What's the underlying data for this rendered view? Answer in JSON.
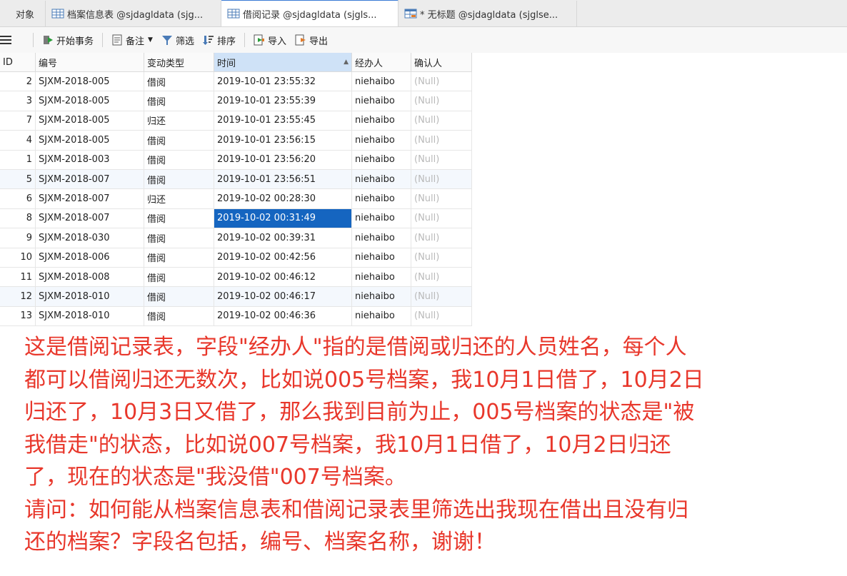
{
  "tabs": [
    {
      "label": "对象",
      "icon": "none"
    },
    {
      "label": "档案信息表 @sjdagldata (sjg...",
      "icon": "table-icon"
    },
    {
      "label": "借阅记录 @sjdagldata (sjgls...",
      "icon": "table-icon"
    },
    {
      "label": "* 无标题 @sjdagldata (sjglse...",
      "icon": "query-icon"
    }
  ],
  "toolbar": {
    "begin_transaction": "开始事务",
    "note": "备注",
    "filter": "筛选",
    "sort": "排序",
    "import": "导入",
    "export": "导出"
  },
  "columns": [
    "ID",
    "编号",
    "变动类型",
    "时间",
    "经办人",
    "确认人"
  ],
  "rows": [
    {
      "id": "2",
      "code": "SJXM-2018-005",
      "type": "借阅",
      "time": "2019-10-01 23:55:32",
      "operator": "niehaibo",
      "confirmer": "(Null)"
    },
    {
      "id": "3",
      "code": "SJXM-2018-005",
      "type": "借阅",
      "time": "2019-10-01 23:55:39",
      "operator": "niehaibo",
      "confirmer": "(Null)"
    },
    {
      "id": "7",
      "code": "SJXM-2018-005",
      "type": "归还",
      "time": "2019-10-01 23:55:45",
      "operator": "niehaibo",
      "confirmer": "(Null)"
    },
    {
      "id": "4",
      "code": "SJXM-2018-005",
      "type": "借阅",
      "time": "2019-10-01 23:56:15",
      "operator": "niehaibo",
      "confirmer": "(Null)"
    },
    {
      "id": "1",
      "code": "SJXM-2018-003",
      "type": "借阅",
      "time": "2019-10-01 23:56:20",
      "operator": "niehaibo",
      "confirmer": "(Null)"
    },
    {
      "id": "5",
      "code": "SJXM-2018-007",
      "type": "借阅",
      "time": "2019-10-01 23:56:51",
      "operator": "niehaibo",
      "confirmer": "(Null)"
    },
    {
      "id": "6",
      "code": "SJXM-2018-007",
      "type": "归还",
      "time": "2019-10-02 00:28:30",
      "operator": "niehaibo",
      "confirmer": "(Null)"
    },
    {
      "id": "8",
      "code": "SJXM-2018-007",
      "type": "借阅",
      "time": "2019-10-02 00:31:49",
      "operator": "niehaibo",
      "confirmer": "(Null)"
    },
    {
      "id": "9",
      "code": "SJXM-2018-030",
      "type": "借阅",
      "time": "2019-10-02 00:39:31",
      "operator": "niehaibo",
      "confirmer": "(Null)"
    },
    {
      "id": "10",
      "code": "SJXM-2018-006",
      "type": "借阅",
      "time": "2019-10-02 00:42:56",
      "operator": "niehaibo",
      "confirmer": "(Null)"
    },
    {
      "id": "11",
      "code": "SJXM-2018-008",
      "type": "借阅",
      "time": "2019-10-02 00:46:12",
      "operator": "niehaibo",
      "confirmer": "(Null)"
    },
    {
      "id": "12",
      "code": "SJXM-2018-010",
      "type": "借阅",
      "time": "2019-10-02 00:46:17",
      "operator": "niehaibo",
      "confirmer": "(Null)"
    },
    {
      "id": "13",
      "code": "SJXM-2018-010",
      "type": "借阅",
      "time": "2019-10-02 00:46:36",
      "operator": "niehaibo",
      "confirmer": "(Null)"
    }
  ],
  "question_lines": [
    "这是借阅记录表，字段\"经办人\"指的是借阅或归还的人员姓名，每个人",
    "都可以借阅归还无数次，比如说005号档案，我10月1日借了，10月2日",
    "归还了，10月3日又借了，那么我到目前为止，005号档案的状态是\"被",
    "我借走\"的状态，比如说007号档案，我10月1日借了，10月2日归还",
    "了，现在的状态是\"我没借\"007号档案。",
    "请问：如何能从档案信息表和借阅记录表里筛选出我现在借出且没有归",
    "还的档案？字段名包括，编号、档案名称，谢谢！"
  ],
  "colors": {
    "question_text": "#e8372b",
    "selection": "#1565c0",
    "sorted_header": "#cfe2f7"
  }
}
